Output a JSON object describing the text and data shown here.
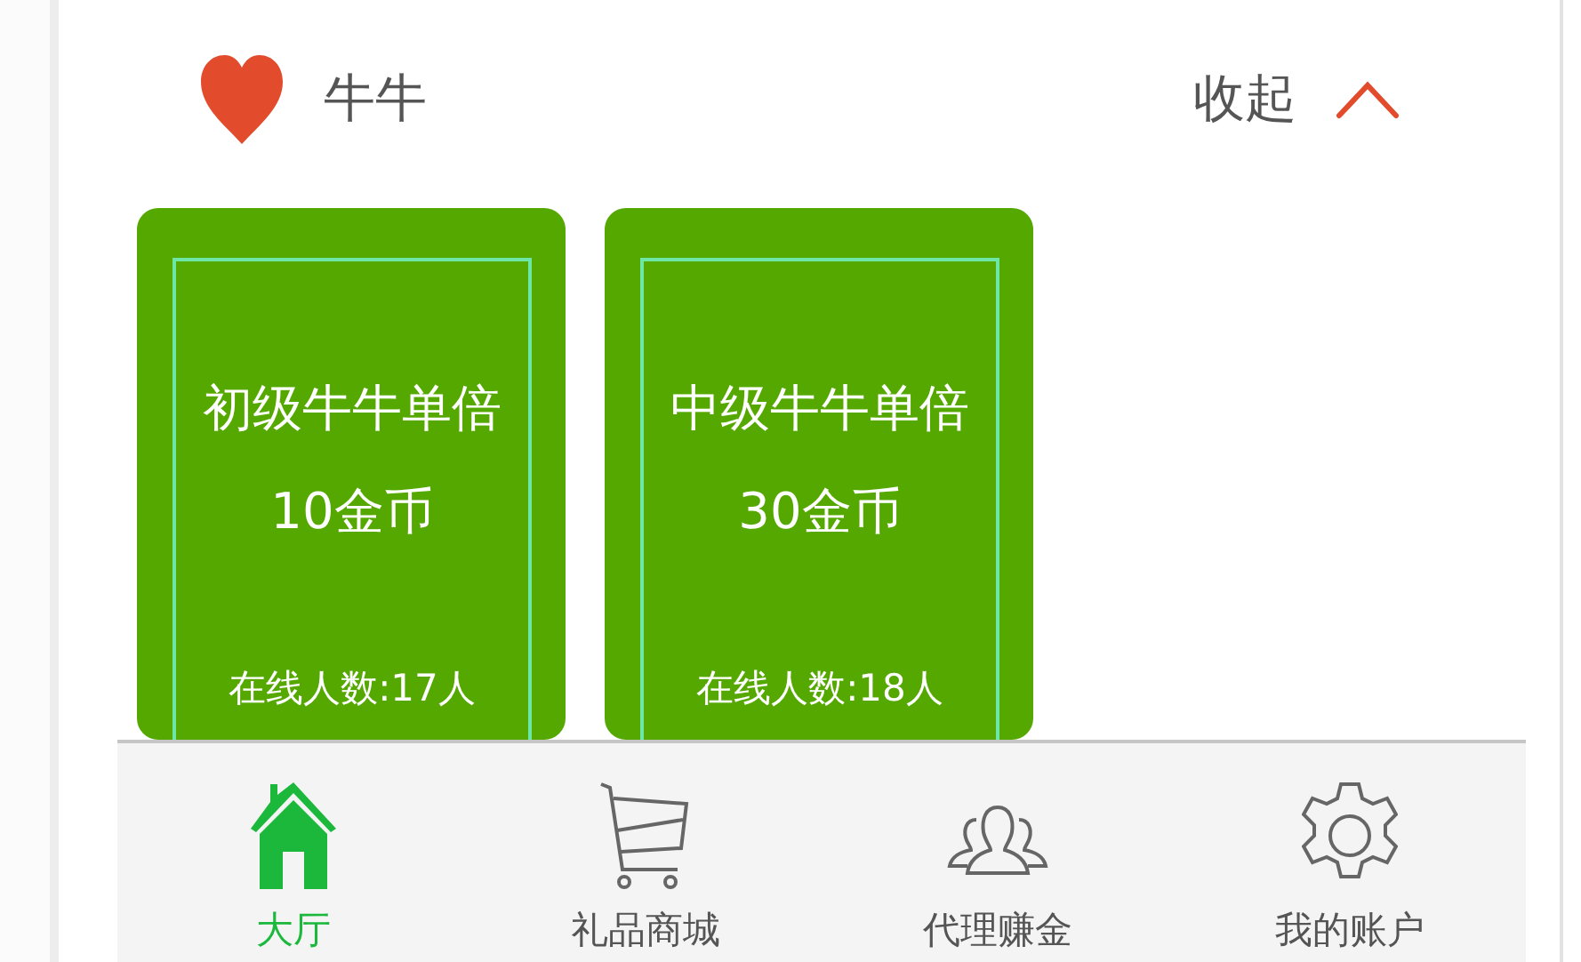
{
  "header": {
    "title": "牛牛",
    "toggle": "收起",
    "expanded": true
  },
  "rooms": [
    {
      "name": "初级牛牛单倍",
      "stake": "10金币",
      "online": "在线人数:17人"
    },
    {
      "name": "中级牛牛单倍",
      "stake": "30金币",
      "online": "在线人数:18人"
    }
  ],
  "nav": [
    {
      "label": "大厅",
      "kind": "home",
      "selected": true
    },
    {
      "label": "礼品商城",
      "kind": "cart",
      "selected": false
    },
    {
      "label": "代理赚金",
      "kind": "people",
      "selected": false
    },
    {
      "label": "我的账户",
      "kind": "gear",
      "selected": false
    }
  ]
}
